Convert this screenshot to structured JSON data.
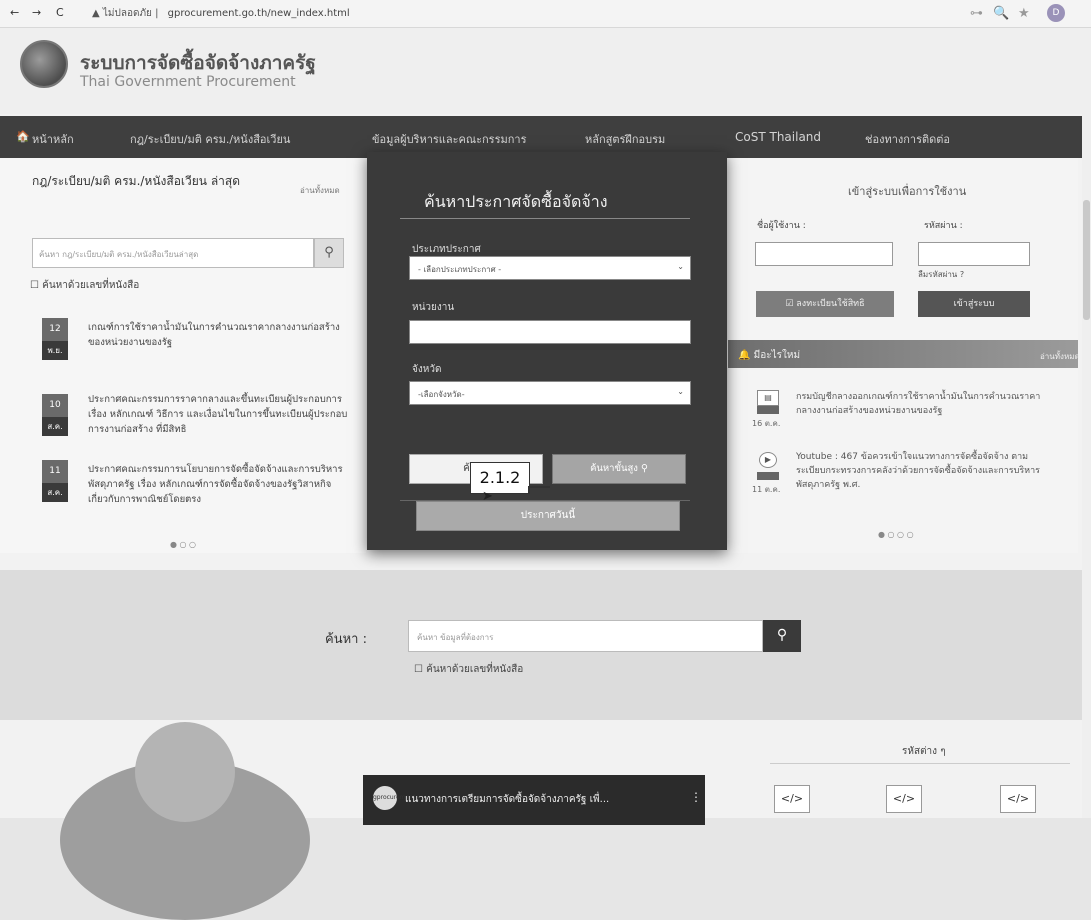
{
  "browser": {
    "back": "←",
    "forward": "→",
    "reload": "C",
    "security": "▲ ไม่ปลอดภัย |",
    "url": "gprocurement.go.th/new_index.html",
    "key_icon": "⊶",
    "zoom_icon": "🔍",
    "star_icon": "★",
    "profile": "D"
  },
  "header": {
    "title": "ระบบการจัดซื้อจัดจ้างภาครัฐ",
    "subtitle": "Thai Government Procurement"
  },
  "nav": {
    "items": [
      "หน้าหลัก",
      "กฎ/ระเบียบ/มติ ครม./หนังสือเวียน",
      "ข้อมูลผู้บริหารและคณะกรรมการ",
      "หลักสูตรฝึกอบรม",
      "CoST Thailand",
      "ช่องทางการติดต่อ"
    ]
  },
  "left": {
    "title": "กฎ/ระเบียบ/มติ ครม./หนังสือเวียน ล่าสุด",
    "more": "อ่านทั้งหมด",
    "search_placeholder": "ค้นหา กฎ/ระเบียบ/มติ ครม./หนังสือเวียนล่าสุด",
    "checkbox": "☐ ค้นหาด้วยเลขที่หนังสือ",
    "news": [
      {
        "day": "12",
        "month": "พ.ย.",
        "text": "เกณฑ์การใช้ราคาน้ำมันในการคำนวณราคากลางงานก่อสร้างของหน่วยงานของรัฐ"
      },
      {
        "day": "10",
        "month": "ส.ค.",
        "text": "ประกาศคณะกรรมการราคากลางและขึ้นทะเบียนผู้ประกอบการ เรื่อง หลักเกณฑ์ วิธีการ และเงื่อนไขในการขึ้นทะเบียนผู้ประกอบการงานก่อสร้าง ที่มีสิทธิ"
      },
      {
        "day": "11",
        "month": "ส.ค.",
        "text": "ประกาศคณะกรรมการนโยบายการจัดซื้อจัดจ้างและการบริหารพัสดุภาครัฐ เรื่อง หลักเกณฑ์การจัดซื้อจัดจ้างของรัฐวิสาหกิจเกี่ยวกับการพาณิชย์โดยตรง"
      }
    ],
    "dots": "● ○ ○"
  },
  "modal": {
    "title": "ค้นหาประกาศจัดซื้อจัดจ้าง",
    "type_label": "ประเภทประกาศ",
    "type_value": "- เลือกประเภทประกาศ -",
    "unit_label": "หน่วยงาน",
    "province_label": "จังหวัด",
    "province_value": "-เลือกจังหวัด-",
    "search_btn": "ค้นหา",
    "adv_btn": "ค้นหาขั้นสูง",
    "publish_btn": "ประกาศวันนี้",
    "callout": "2.1.2"
  },
  "right": {
    "login_title": "เข้าสู่ระบบเพื่อการใช้งาน",
    "user_label": "ชื่อผู้ใช้งาน :",
    "pass_label": "รหัสผ่าน :",
    "forgot": "ลืมรหัสผ่าน ?",
    "register": "ลงทะเบียนใช้สิทธิ",
    "login": "เข้าสู่ระบบ",
    "news_title": "มีอะไรใหม่",
    "news_all": "อ่านทั้งหมด",
    "news": [
      {
        "date": "16 ต.ค.",
        "text": "กรมบัญชีกลางออกเกณฑ์การใช้ราคาน้ำมันในการคำนวณราคากลางงานก่อสร้างของหน่วยงานของรัฐ"
      },
      {
        "date": "11 ต.ค.",
        "text": "Youtube : 467 ข้อควรเข้าใจแนวทางการจัดซื้อจัดจ้าง ตามระเบียบกระทรวงการคลังว่าด้วยการจัดซื้อจัดจ้างและการบริหารพัสดุภาครัฐ พ.ศ."
      }
    ],
    "dots": "● ○ ○ ○"
  },
  "search": {
    "label": "ค้นหา :",
    "placeholder": "ค้นหา ข้อมูลที่ต้องการ",
    "checkbox": "☐ ค้นหาด้วยเลขที่หนังสือ"
  },
  "bottom": {
    "video_logo": "gprocurement",
    "video_title": "แนวทางการเตรียมการจัดซื้อจัดจ้างภาครัฐ เพื่...",
    "video_menu": "⋮",
    "codes_title": "รหัสต่าง ๆ",
    "code_icon": "</>"
  }
}
